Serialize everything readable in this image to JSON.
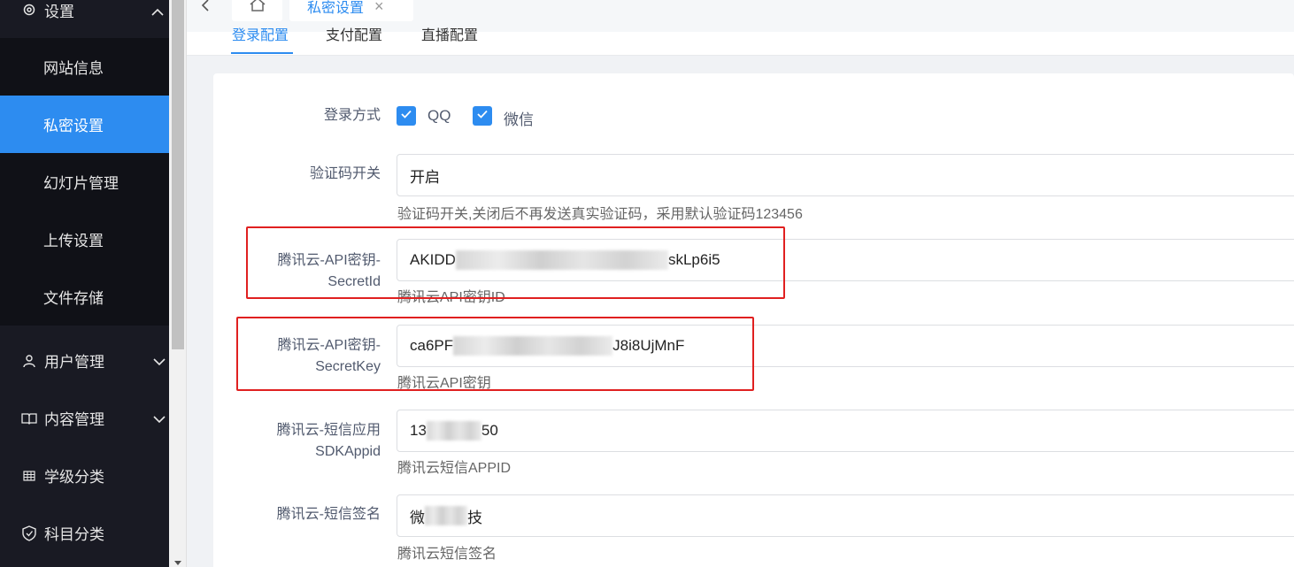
{
  "sidebar": {
    "settings_label": "设置",
    "sub_items": [
      {
        "label": "网站信息",
        "active": false
      },
      {
        "label": "私密设置",
        "active": true
      },
      {
        "label": "幻灯片管理",
        "active": false
      },
      {
        "label": "上传设置",
        "active": false
      },
      {
        "label": "文件存储",
        "active": false
      }
    ],
    "groups": [
      {
        "label": "用户管理",
        "icon": "user-icon",
        "expandable": true
      },
      {
        "label": "内容管理",
        "icon": "book-icon",
        "expandable": true
      },
      {
        "label": "学级分类",
        "icon": "grid-icon",
        "expandable": false
      },
      {
        "label": "科目分类",
        "icon": "shield-icon",
        "expandable": false
      }
    ]
  },
  "tabs": {
    "home_icon": "home-icon",
    "open_tab": "私密设置"
  },
  "subtabs": [
    "登录配置",
    "支付配置",
    "直播配置"
  ],
  "form": {
    "login_method": {
      "label": "登录方式",
      "options": [
        {
          "label": "QQ",
          "checked": true
        },
        {
          "label": "微信",
          "checked": true
        }
      ]
    },
    "captcha": {
      "label": "验证码开关",
      "value": "开启",
      "hint": "验证码开关,关闭后不再发送真实验证码，采用默认验证码123456"
    },
    "secret_id": {
      "label_line1": "腾讯云-API密钥-",
      "label_line2": "SecretId",
      "value_prefix": "AKIDD",
      "value_suffix": "skLp6i5",
      "hint": "腾讯云API密钥ID"
    },
    "secret_key": {
      "label_line1": "腾讯云-API密钥-",
      "label_line2": "SecretKey",
      "value_prefix": "ca6PF",
      "value_suffix": "J8i8UjMnF",
      "hint": "腾讯云API密钥"
    },
    "sdk_appid": {
      "label_line1": "腾讯云-短信应用",
      "label_line2": "SDKAppid",
      "value_prefix": "13",
      "value_suffix": "50",
      "hint": "腾讯云短信APPID"
    },
    "sms_sign": {
      "label": "腾讯云-短信签名",
      "value_prefix": "微",
      "value_suffix": "技",
      "hint": "腾讯云短信签名"
    }
  },
  "colors": {
    "primary": "#2d8cf0",
    "sidebar_bg": "#191a23",
    "highlight_red": "#e02020"
  }
}
